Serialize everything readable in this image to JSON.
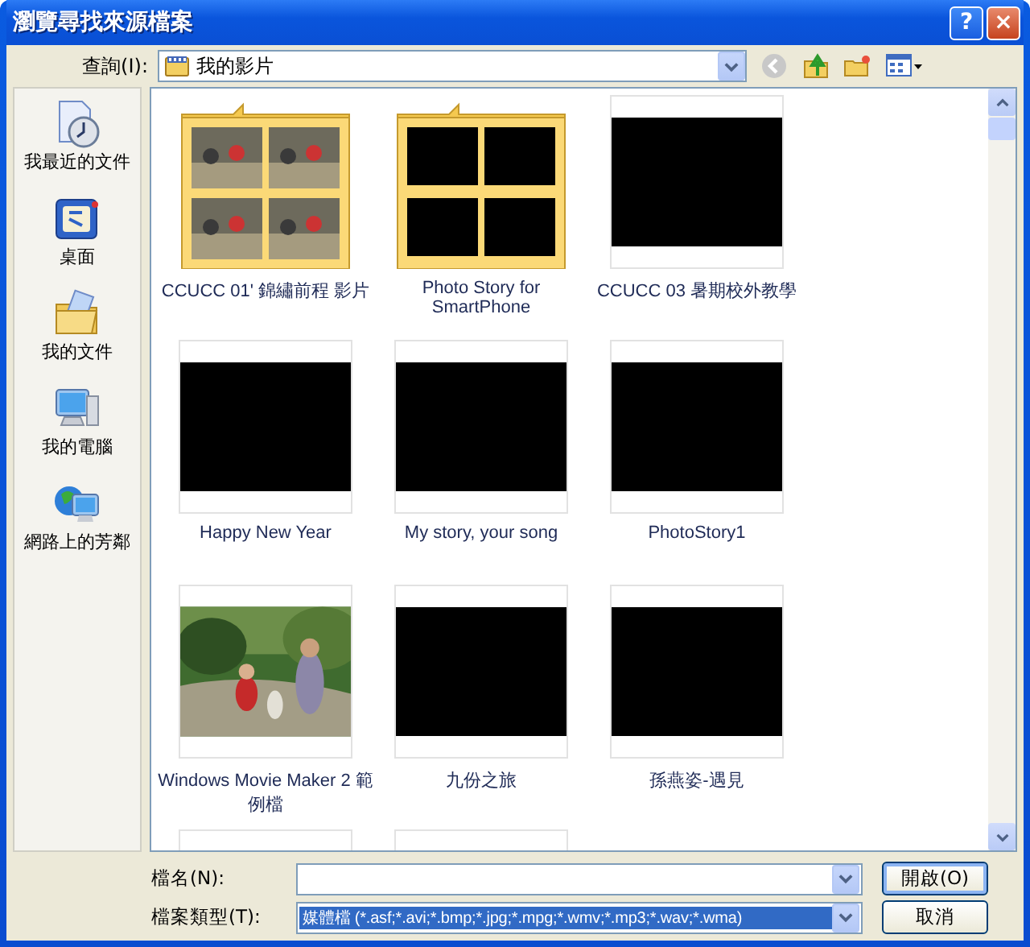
{
  "window": {
    "title": "瀏覽尋找來源檔案",
    "buttons": [
      "?",
      "×"
    ]
  },
  "look_in": {
    "label": "查詢(I):",
    "value": "我的影片"
  },
  "places": [
    {
      "label": "我最近的文件",
      "kind": "recent"
    },
    {
      "label": "桌面",
      "kind": "desktop"
    },
    {
      "label": "我的文件",
      "kind": "documents"
    },
    {
      "label": "我的電腦",
      "kind": "computer"
    },
    {
      "label": "網路上的芳鄰",
      "kind": "network"
    }
  ],
  "files": [
    {
      "name": "CCUCC 01' 錦繡前程 影片",
      "kind": "photo-folder"
    },
    {
      "name": "Photo Story for SmartPhone",
      "kind": "folder"
    },
    {
      "name": "CCUCC 03 暑期校外教學",
      "kind": "video"
    },
    {
      "name": "Happy New Year",
      "kind": "video"
    },
    {
      "name": "My story, your song",
      "kind": "video"
    },
    {
      "name": "PhotoStory1",
      "kind": "video"
    },
    {
      "name": "Windows Movie Maker 2 範例檔",
      "kind": "photo-video"
    },
    {
      "name": "九份之旅",
      "kind": "video"
    },
    {
      "name": "孫燕姿-遇見",
      "kind": "video"
    },
    {
      "kind": "cut-off"
    },
    {
      "kind": "cut-off"
    }
  ],
  "file_name": {
    "label": "檔名(N):"
  },
  "file_type": {
    "label": "檔案類型(T):",
    "value": "媒體檔 (*.asf;*.avi;*.bmp;*.jpg;*.mpg;*.wmv;*.mp3;*.wav;*.wma)"
  },
  "buttons": [
    {
      "label": "開啟(O)",
      "default": true
    },
    {
      "label": "取消",
      "default": false
    }
  ]
}
